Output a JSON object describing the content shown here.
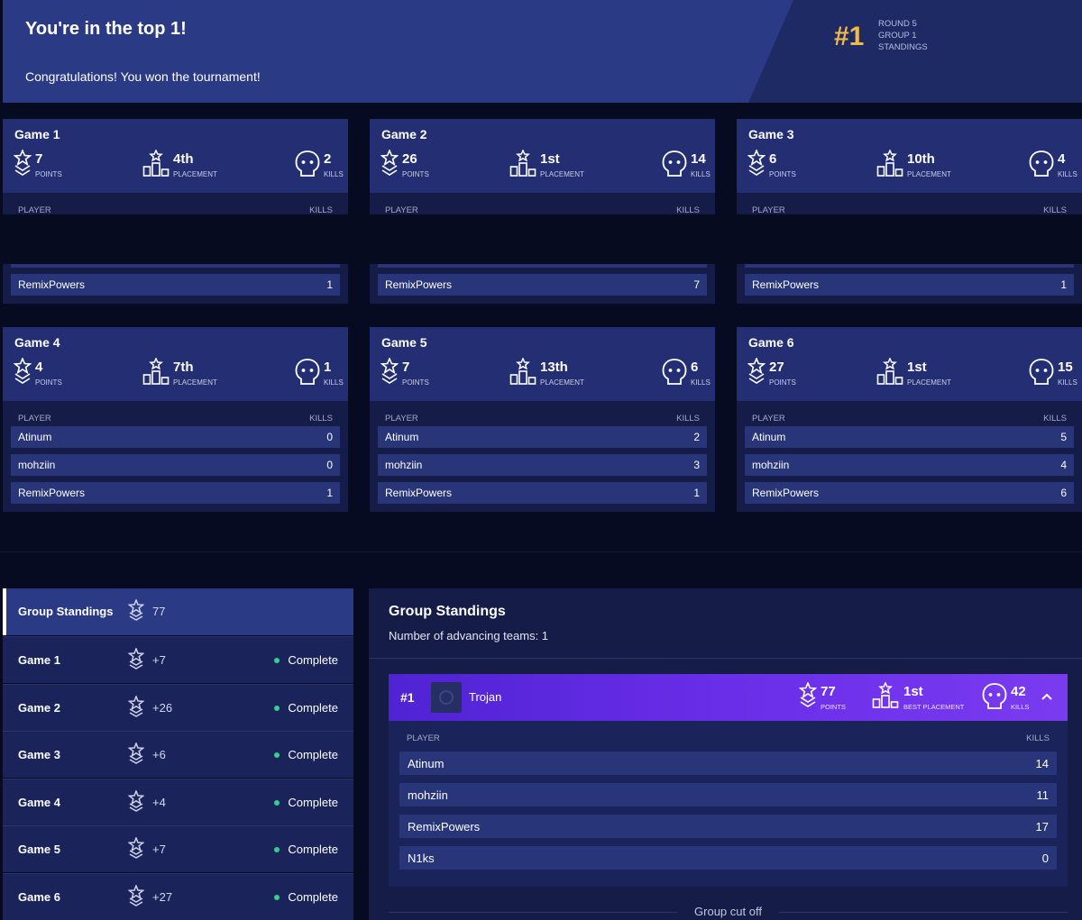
{
  "banner": {
    "title": "You're in the top 1!",
    "subtitle": "Congratulations! You won the tournament!",
    "rank": "#1",
    "round": "ROUND 5",
    "group": "GROUP 1",
    "standings": "STANDINGS"
  },
  "labels": {
    "points": "POINTS",
    "placement": "PLACEMENT",
    "kills": "KILLS",
    "player": "PLAYER",
    "kills_col": "KILLS",
    "best_placement": "BEST PLACEMENT"
  },
  "games": [
    {
      "title": "Game 1",
      "points": "7",
      "placement": "4th",
      "kills": "2",
      "players": [
        {
          "name": "",
          "kills": ""
        },
        {
          "name": "",
          "kills": ""
        },
        {
          "name": "RemixPowers",
          "kills": "1"
        }
      ]
    },
    {
      "title": "Game 2",
      "points": "26",
      "placement": "1st",
      "kills": "14",
      "players": [
        {
          "name": "",
          "kills": ""
        },
        {
          "name": "",
          "kills": ""
        },
        {
          "name": "RemixPowers",
          "kills": "7"
        }
      ]
    },
    {
      "title": "Game 3",
      "points": "6",
      "placement": "10th",
      "kills": "4",
      "players": [
        {
          "name": "",
          "kills": ""
        },
        {
          "name": "",
          "kills": ""
        },
        {
          "name": "RemixPowers",
          "kills": "1"
        }
      ]
    },
    {
      "title": "Game 4",
      "points": "4",
      "placement": "7th",
      "kills": "1",
      "players": [
        {
          "name": "Atinum",
          "kills": "0"
        },
        {
          "name": "mohziin",
          "kills": "0"
        },
        {
          "name": "RemixPowers",
          "kills": "1"
        }
      ]
    },
    {
      "title": "Game 5",
      "points": "7",
      "placement": "13th",
      "kills": "6",
      "players": [
        {
          "name": "Atinum",
          "kills": "2"
        },
        {
          "name": "mohziin",
          "kills": "3"
        },
        {
          "name": "RemixPowers",
          "kills": "1"
        }
      ]
    },
    {
      "title": "Game 6",
      "points": "27",
      "placement": "1st",
      "kills": "15",
      "players": [
        {
          "name": "Atinum",
          "kills": "5"
        },
        {
          "name": "mohziin",
          "kills": "4"
        },
        {
          "name": "RemixPowers",
          "kills": "6"
        }
      ]
    }
  ],
  "sidebar": {
    "standings_label": "Group Standings",
    "standings_points": "77",
    "items": [
      {
        "label": "Game 1",
        "points": "+7",
        "status": "Complete"
      },
      {
        "label": "Game 2",
        "points": "+26",
        "status": "Complete"
      },
      {
        "label": "Game 3",
        "points": "+6",
        "status": "Complete"
      },
      {
        "label": "Game 4",
        "points": "+4",
        "status": "Complete"
      },
      {
        "label": "Game 5",
        "points": "+7",
        "status": "Complete"
      },
      {
        "label": "Game 6",
        "points": "+27",
        "status": "Complete"
      }
    ]
  },
  "panel": {
    "title": "Group Standings",
    "subtitle": "Number of advancing teams: 1",
    "cutoff": "Group cut off",
    "team": {
      "rank": "#1",
      "name": "Trojan",
      "points": "77",
      "placement": "1st",
      "kills": "42",
      "players": [
        {
          "name": "Atinum",
          "kills": "14"
        },
        {
          "name": "mohziin",
          "kills": "11"
        },
        {
          "name": "RemixPowers",
          "kills": "17"
        },
        {
          "name": "N1ks",
          "kills": "0"
        }
      ]
    }
  },
  "colors": {
    "accent_gold": "#f3b84a",
    "team_purple": "#6a2ee8",
    "status_green": "#31d18b"
  }
}
